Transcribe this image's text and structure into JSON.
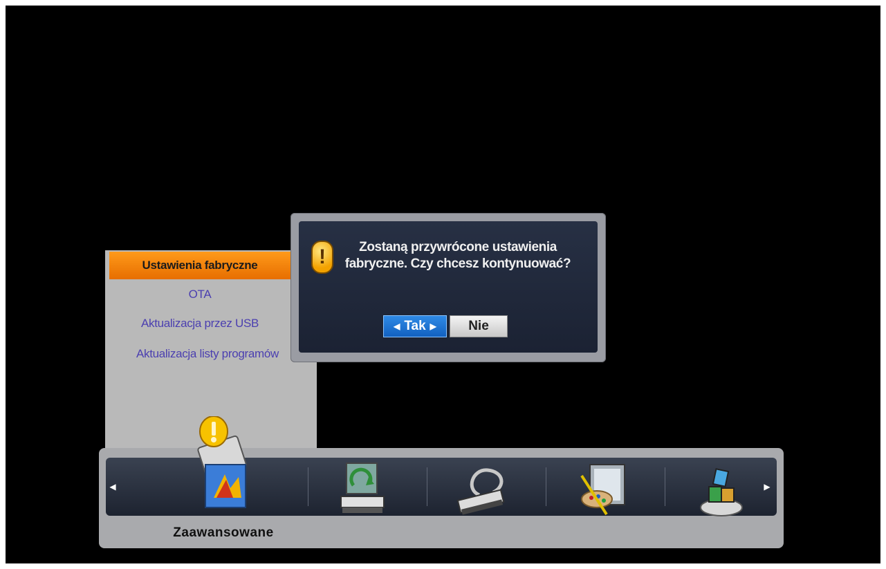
{
  "submenu": {
    "items": [
      {
        "label": "Ustawienia fabryczne",
        "selected": true
      },
      {
        "label": "OTA",
        "selected": false
      },
      {
        "label": "Aktualizacja przez USB",
        "selected": false
      },
      {
        "label": "Aktualizacja listy programów",
        "selected": false
      }
    ]
  },
  "dialog": {
    "message_line1": "Zostaną przywrócone ustawienia",
    "message_line2": "fabryczne. Czy chcesz kontynuować?",
    "yes_label": "Tak",
    "no_label": "Nie",
    "focused_button": "Tak"
  },
  "bottom_menu": {
    "current_label": "Zaawansowane",
    "icons": [
      "advanced-settings-icon",
      "receiver-sync-icon",
      "connection-cable-icon",
      "picture-settings-icon",
      "games-blocks-icon"
    ]
  },
  "colors": {
    "accent_orange": "#f08000",
    "focus_blue": "#1e74d8",
    "dialog_bg": "#222a3a"
  }
}
